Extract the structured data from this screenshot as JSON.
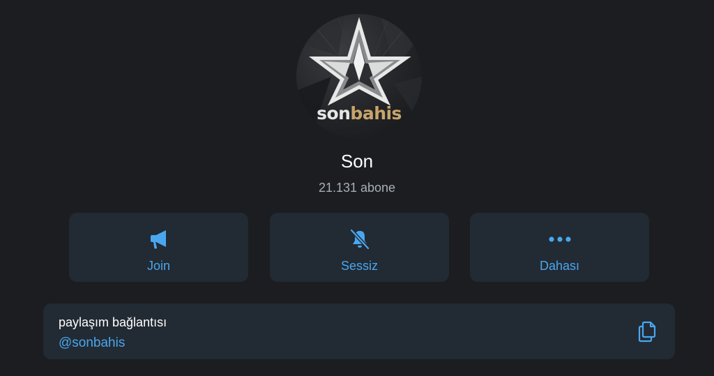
{
  "channel": {
    "name": "Son",
    "subscribers": "21.131 abone",
    "avatar": {
      "logo_text_part1": "son",
      "logo_text_part2": "bahis",
      "logo_icon": "star-icon"
    }
  },
  "actions": [
    {
      "label": "Join",
      "icon": "megaphone-icon"
    },
    {
      "label": "Sessiz",
      "icon": "bell-muted-icon"
    },
    {
      "label": "Dahası",
      "icon": "more-dots-icon"
    }
  ],
  "share_link": {
    "title": "paylaşım bağlantısı",
    "handle": "@sonbahis",
    "icon": "copy-icon"
  },
  "colors": {
    "background": "#1b1d21",
    "card": "#222a33",
    "accent": "#4aa7ef",
    "secondary_text": "#a9afb7",
    "logo_gold": "#c9a56a"
  }
}
